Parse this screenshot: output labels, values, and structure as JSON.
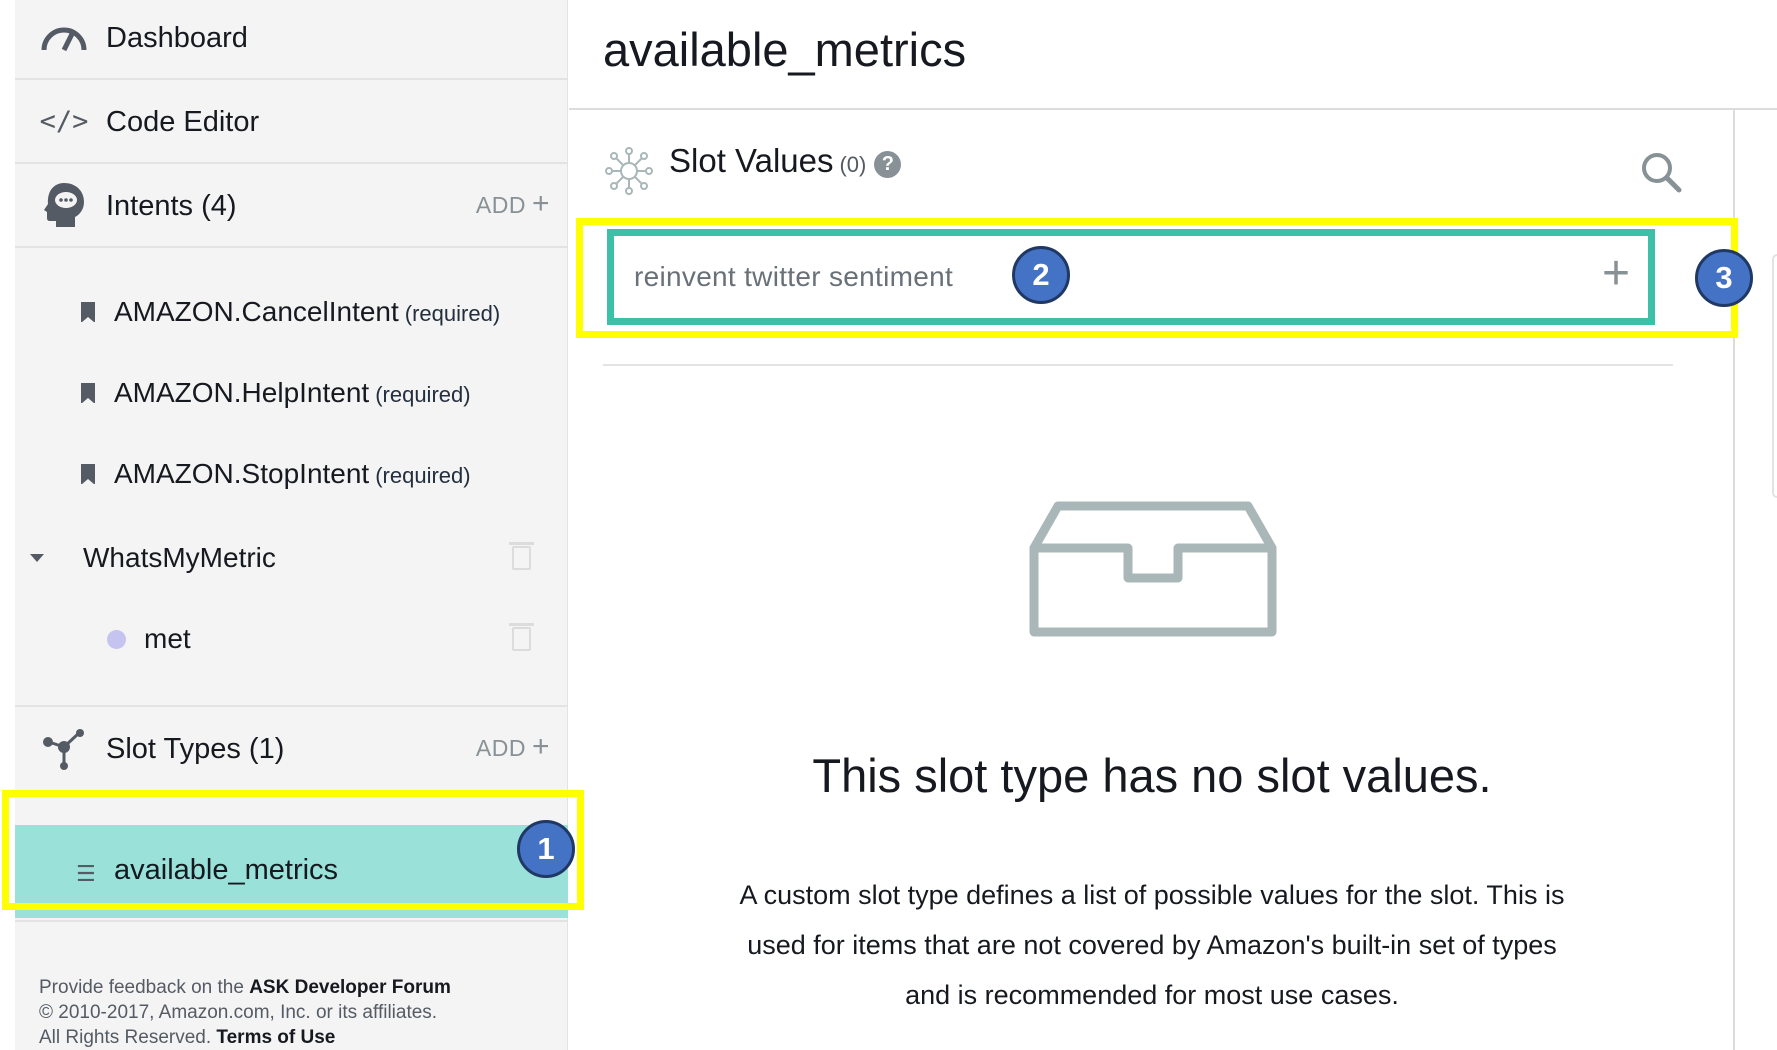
{
  "sidebar": {
    "dashboard_label": "Dashboard",
    "code_editor_label": "Code Editor",
    "intents_label": "Intents (4)",
    "add_label": "ADD",
    "add_plus": "+",
    "intents": [
      {
        "name": "AMAZON.CancelIntent",
        "note": "(required)"
      },
      {
        "name": "AMAZON.HelpIntent",
        "note": "(required)"
      },
      {
        "name": "AMAZON.StopIntent",
        "note": "(required)"
      }
    ],
    "custom_intent": "WhatsMyMetric",
    "slot_name": "met",
    "slot_types_label": "Slot Types (1)",
    "selected_slot_type": "available_metrics",
    "footer": {
      "line1_prefix": "Provide feedback on the ",
      "line1_link": "ASK Developer Forum",
      "line2": "© 2010-2017, Amazon.com, Inc. or its affiliates.",
      "line3_prefix": "All Rights Reserved. ",
      "line3_link": "Terms of Use"
    }
  },
  "main": {
    "page_title": "available_metrics",
    "slot_values_label": "Slot Values",
    "slot_values_count": "(0)",
    "help_glyph": "?",
    "input_value": "reinvent twitter sentiment",
    "add_value_glyph": "+",
    "empty_title": "This slot type has no slot values.",
    "empty_desc_line1": "A custom slot type defines a list of possible values for the slot. This is",
    "empty_desc_line2": "used for items that are not covered by Amazon's built-in set of types",
    "empty_desc_line3": "and is recommended for most use cases."
  },
  "annotations": {
    "badge1": "1",
    "badge2": "2",
    "badge3": "3",
    "highlight_color": "#ffff00",
    "badge_color": "#4472c4",
    "focus_border_color": "#3ebfa8",
    "selected_row_color": "#99e1d9"
  }
}
